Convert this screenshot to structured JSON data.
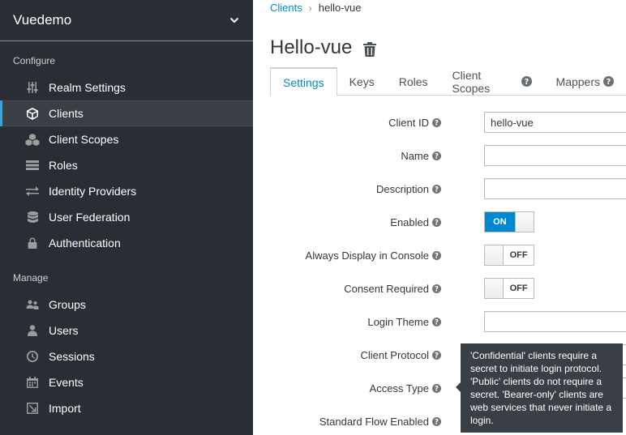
{
  "sidebar": {
    "realm_name": "Vuedemo",
    "configure_label": "Configure",
    "manage_label": "Manage",
    "configure_items": [
      {
        "label": "Realm Settings",
        "icon": "sliders-icon"
      },
      {
        "label": "Clients",
        "icon": "cube-icon",
        "active": true
      },
      {
        "label": "Client Scopes",
        "icon": "cubes-icon"
      },
      {
        "label": "Roles",
        "icon": "list-icon"
      },
      {
        "label": "Identity Providers",
        "icon": "exchange-icon"
      },
      {
        "label": "User Federation",
        "icon": "database-icon"
      },
      {
        "label": "Authentication",
        "icon": "lock-icon"
      }
    ],
    "manage_items": [
      {
        "label": "Groups",
        "icon": "users-icon"
      },
      {
        "label": "Users",
        "icon": "user-icon"
      },
      {
        "label": "Sessions",
        "icon": "clock-icon"
      },
      {
        "label": "Events",
        "icon": "calendar-icon"
      },
      {
        "label": "Import",
        "icon": "import-icon"
      }
    ]
  },
  "breadcrumb": {
    "parent": "Clients",
    "current": "hello-vue"
  },
  "page_title": "Hello-vue",
  "tabs": [
    {
      "label": "Settings",
      "active": true
    },
    {
      "label": "Keys"
    },
    {
      "label": "Roles"
    },
    {
      "label": "Client Scopes",
      "help": true
    },
    {
      "label": "Mappers",
      "help": true
    }
  ],
  "form": {
    "client_id": {
      "label": "Client ID",
      "value": "hello-vue"
    },
    "name": {
      "label": "Name",
      "value": ""
    },
    "description": {
      "label": "Description",
      "value": ""
    },
    "enabled": {
      "label": "Enabled",
      "state": "ON"
    },
    "always_display": {
      "label": "Always Display in Console",
      "state": "OFF"
    },
    "consent_required": {
      "label": "Consent Required",
      "state": "OFF"
    },
    "login_theme": {
      "label": "Login Theme",
      "value": ""
    },
    "client_protocol": {
      "label": "Client Protocol"
    },
    "access_type": {
      "label": "Access Type"
    },
    "standard_flow": {
      "label": "Standard Flow Enabled"
    }
  },
  "tooltip": {
    "text": "'Confidential' clients require a secret to initiate login protocol. 'Public' clients do not require a secret. 'Bearer-only' clients are web services that never initiate a login."
  },
  "colors": {
    "accent": "#0088ce",
    "sidebar_bg": "#292e34",
    "tooltip_bg": "#393f44"
  }
}
